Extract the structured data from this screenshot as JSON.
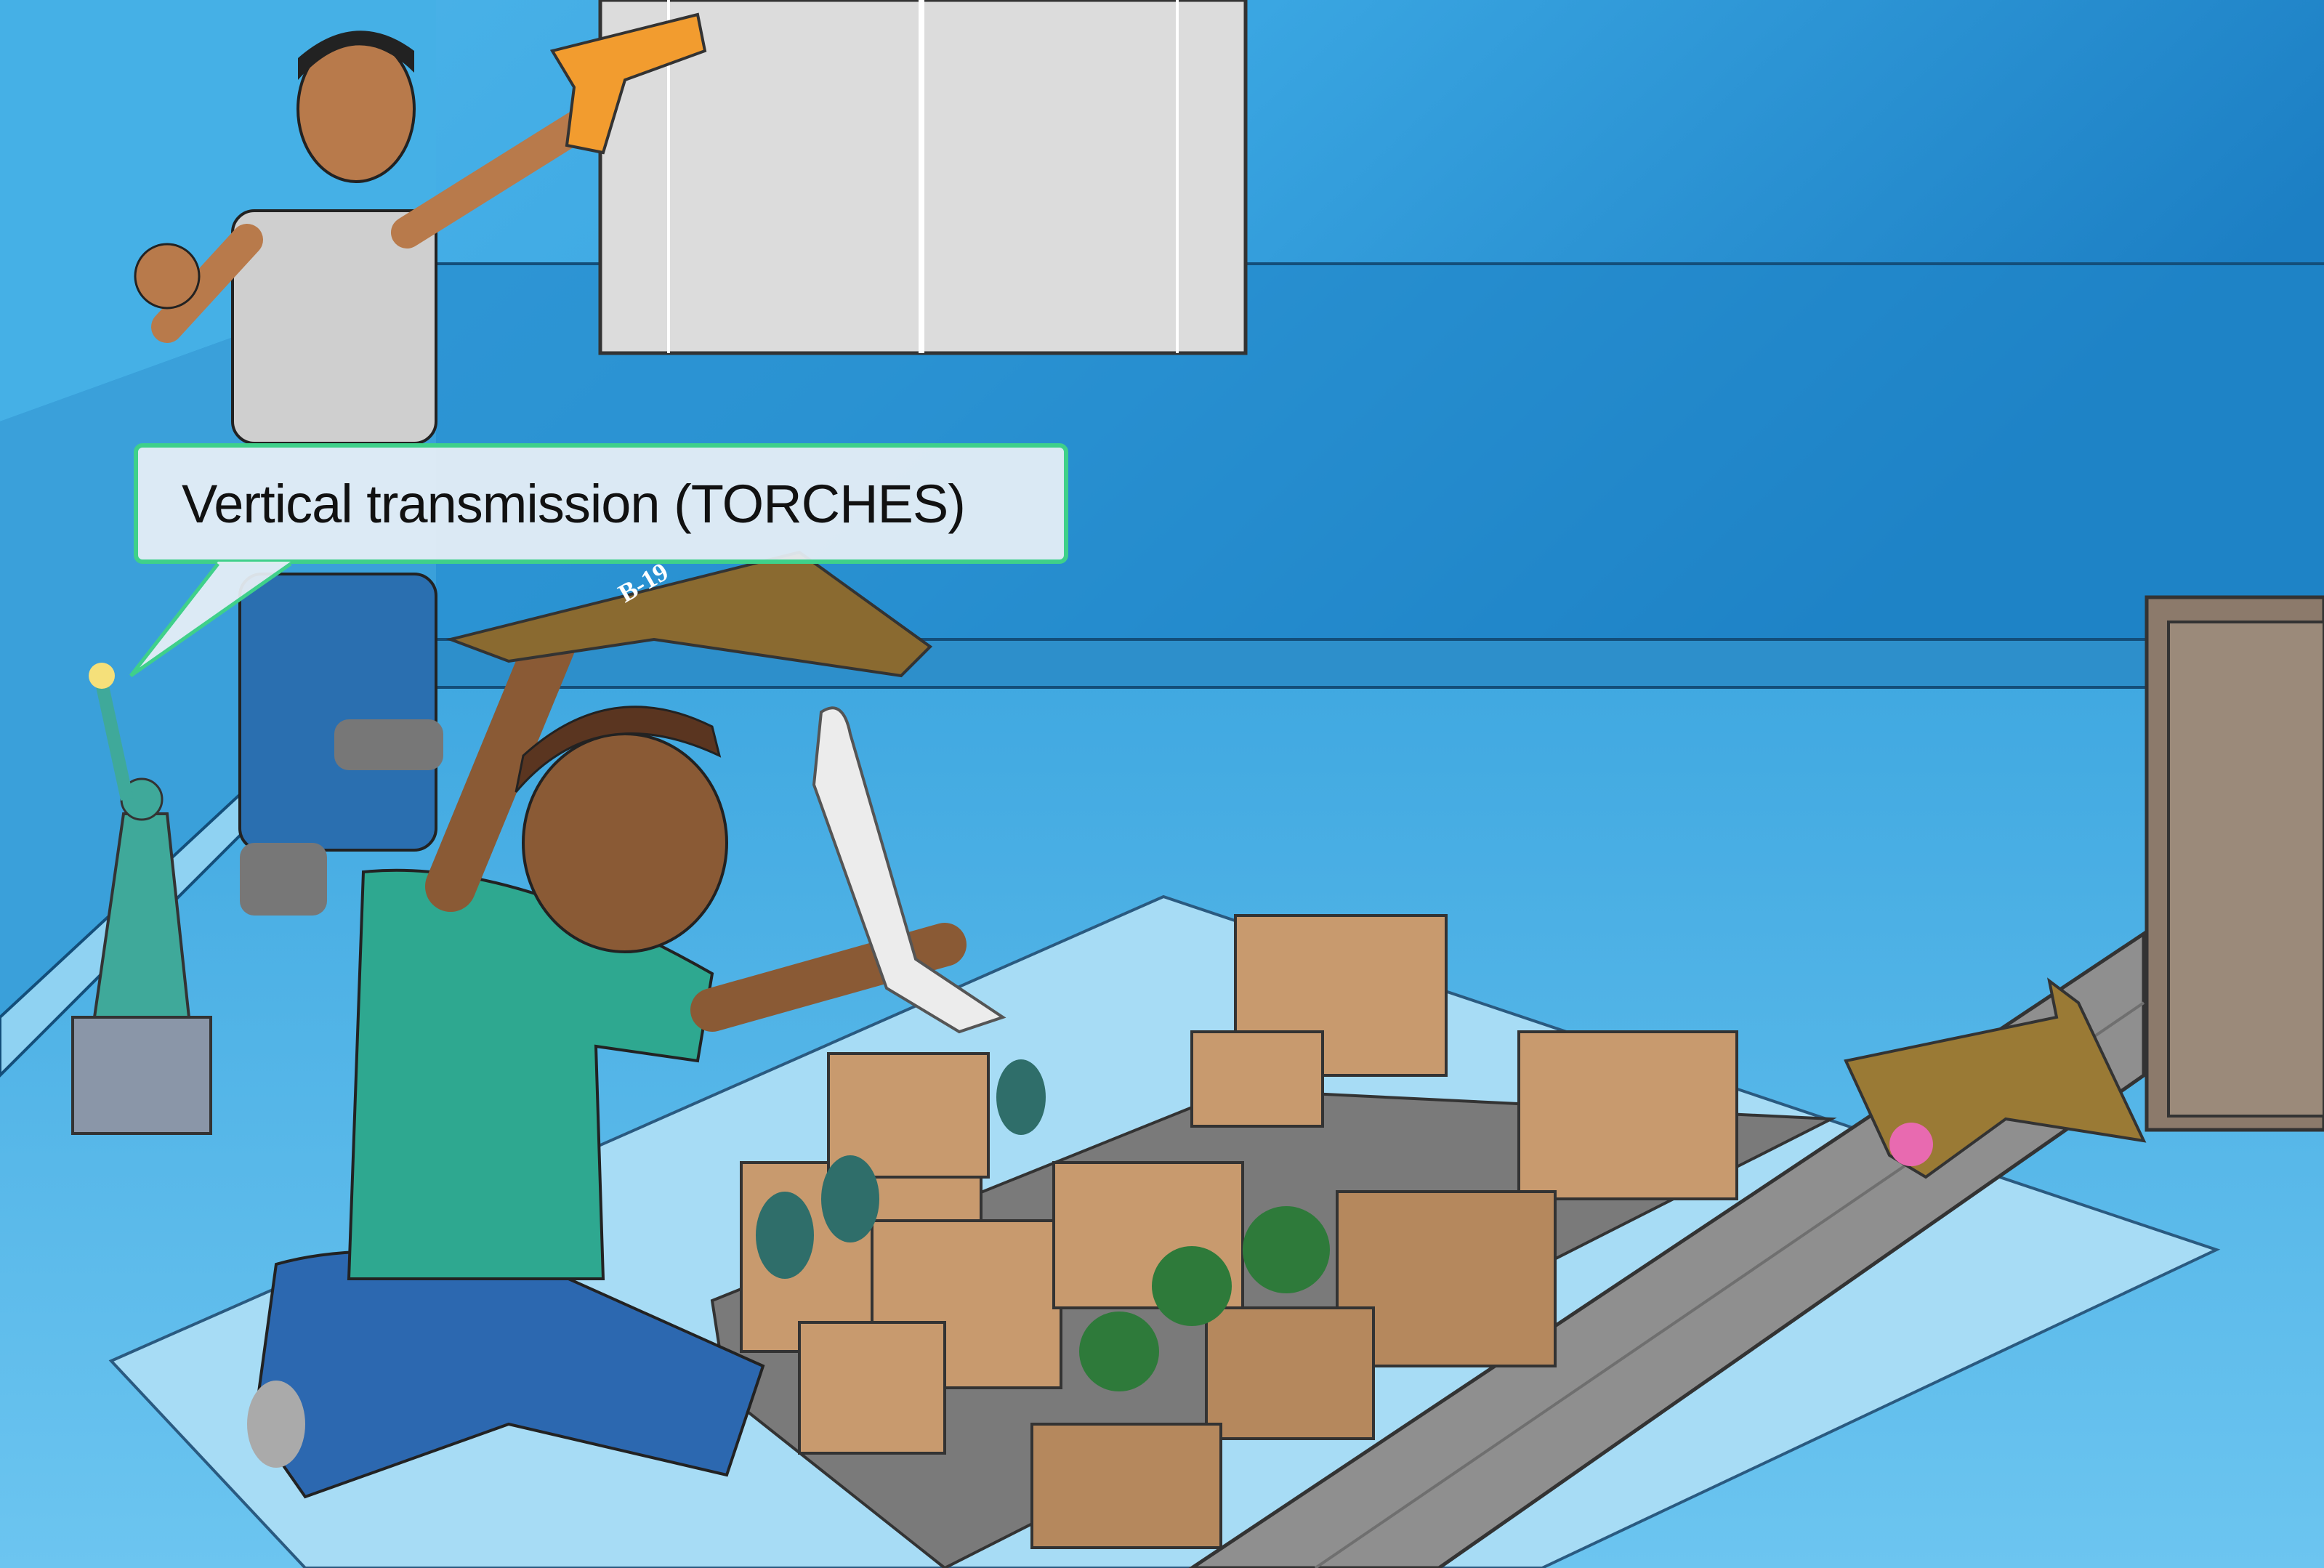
{
  "speech_bubble": {
    "text": "Vertical transmission (TORCHES)",
    "border_color": "#3fd08a"
  },
  "scene": {
    "plane_marking": "B-19",
    "colors": {
      "wall": "#2a8fd0",
      "floor": "#5ab8ea",
      "mat": "#a7dcf5",
      "road": "#8f8f8f"
    }
  }
}
